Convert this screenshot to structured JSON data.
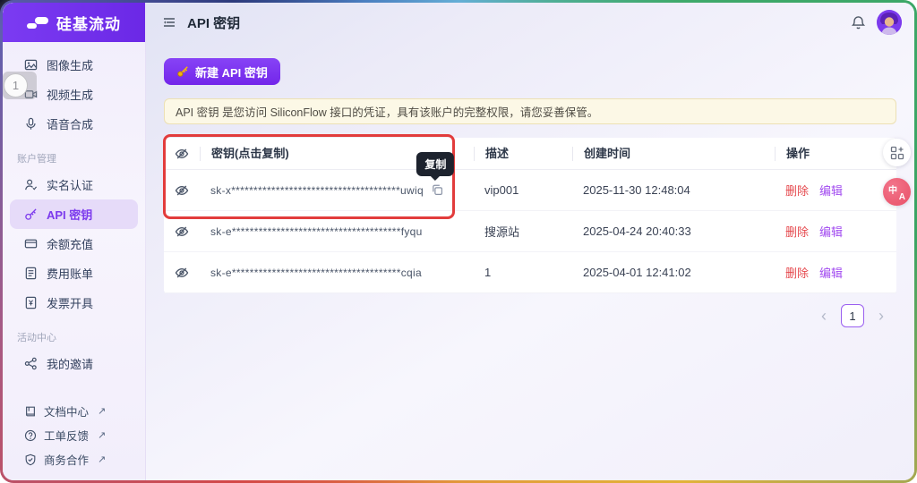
{
  "colors": {
    "accent": "#7C3AED",
    "danger": "#E5484D",
    "edit": "#A24BF0",
    "banner_bg": "#FCF8E6",
    "annotation_red": "#E23C3C",
    "translate_pink": "#E94F67"
  },
  "sidebar": {
    "logo_text": "硅基流动",
    "nav_main": [
      {
        "label": "图像生成",
        "icon": "image-icon"
      },
      {
        "label": "视频生成",
        "icon": "video-icon"
      },
      {
        "label": "语音合成",
        "icon": "microphone-icon"
      }
    ],
    "section_account": "账户管理",
    "nav_account": [
      {
        "label": "实名认证",
        "icon": "person-check-icon"
      },
      {
        "label": "API 密钥",
        "icon": "key-icon",
        "active": true
      },
      {
        "label": "余额充值",
        "icon": "credit-card-icon"
      },
      {
        "label": "费用账单",
        "icon": "bill-icon"
      },
      {
        "label": "发票开具",
        "icon": "invoice-icon"
      }
    ],
    "section_activity": "活动中心",
    "nav_activity": [
      {
        "label": "我的邀请",
        "icon": "share-icon"
      }
    ],
    "nav_footer": [
      {
        "label": "文档中心",
        "icon": "book-icon"
      },
      {
        "label": "工单反馈",
        "icon": "help-circle-icon"
      },
      {
        "label": "商务合作",
        "icon": "shield-icon"
      }
    ],
    "external_arrow": "↗"
  },
  "annotation_badge": "1",
  "header": {
    "title": "API 密钥"
  },
  "toolbar": {
    "new_key_label": "新建 API 密钥"
  },
  "banner": {
    "text": "API 密钥 是您访问 SiliconFlow 接口的凭证，具有该账户的完整权限，请您妥善保管。"
  },
  "tooltip": {
    "copy": "复制"
  },
  "table": {
    "columns": {
      "key": "密钥(点击复制)",
      "desc": "描述",
      "created": "创建时间",
      "ops": "操作"
    },
    "actions": {
      "delete": "删除",
      "edit": "编辑"
    },
    "rows": [
      {
        "key": "sk-x**************************************uwiq",
        "desc": "vip001",
        "created": "2025-11-30 12:48:04"
      },
      {
        "key": "sk-e**************************************fyqu",
        "desc": "搜源站",
        "created": "2025-04-24 20:40:33"
      },
      {
        "key": "sk-e**************************************cqia",
        "desc": "1",
        "created": "2025-04-01 12:41:02"
      }
    ]
  },
  "pagination": {
    "prev": "‹",
    "current": "1",
    "next": "›"
  },
  "floating": {
    "translate_zh": "中",
    "translate_a": "A"
  }
}
